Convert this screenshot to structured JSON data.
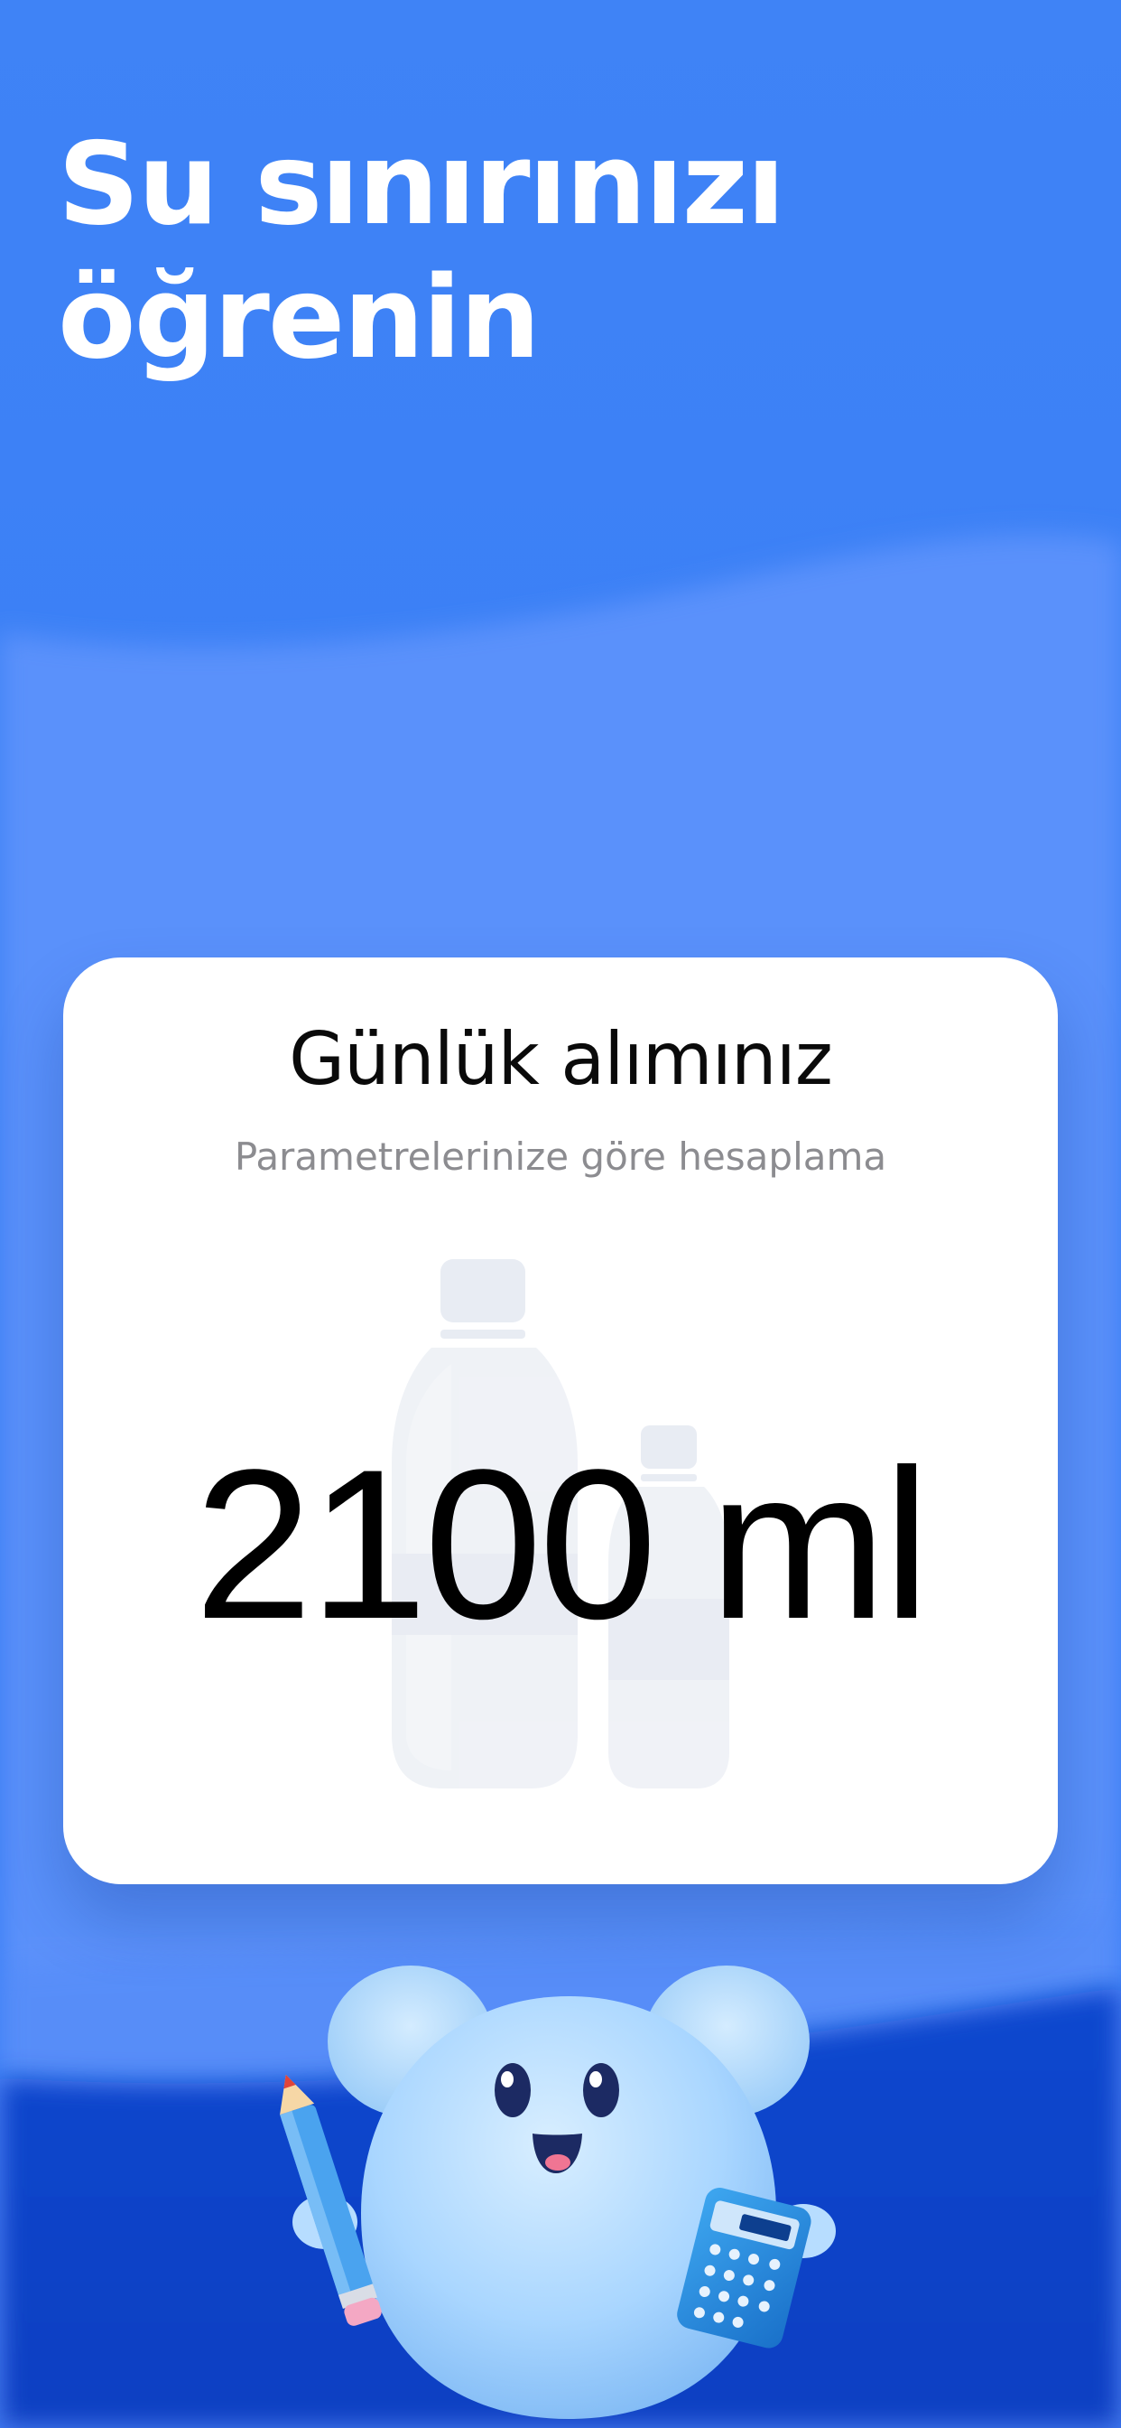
{
  "headline": {
    "line1": "Su sınırınızı",
    "line2": "öğrenin"
  },
  "intake_card": {
    "title": "Günlük alımınız",
    "subtitle": "Parametrelerinize göre hesaplama",
    "amount": "2100 ml"
  },
  "illustration": {
    "bottles_icon": "water-bottles-icon",
    "mascot": "water-drop-mascot",
    "props": [
      "pencil-icon",
      "calculator-icon"
    ]
  },
  "colors": {
    "top_blue": "#3a7ff5",
    "mid_blue": "#5b92fb",
    "bottom_blue": "#0a43c7",
    "card_bg": "#ffffff",
    "amount_text": "#000000",
    "subtitle_text": "#8c8c90"
  }
}
